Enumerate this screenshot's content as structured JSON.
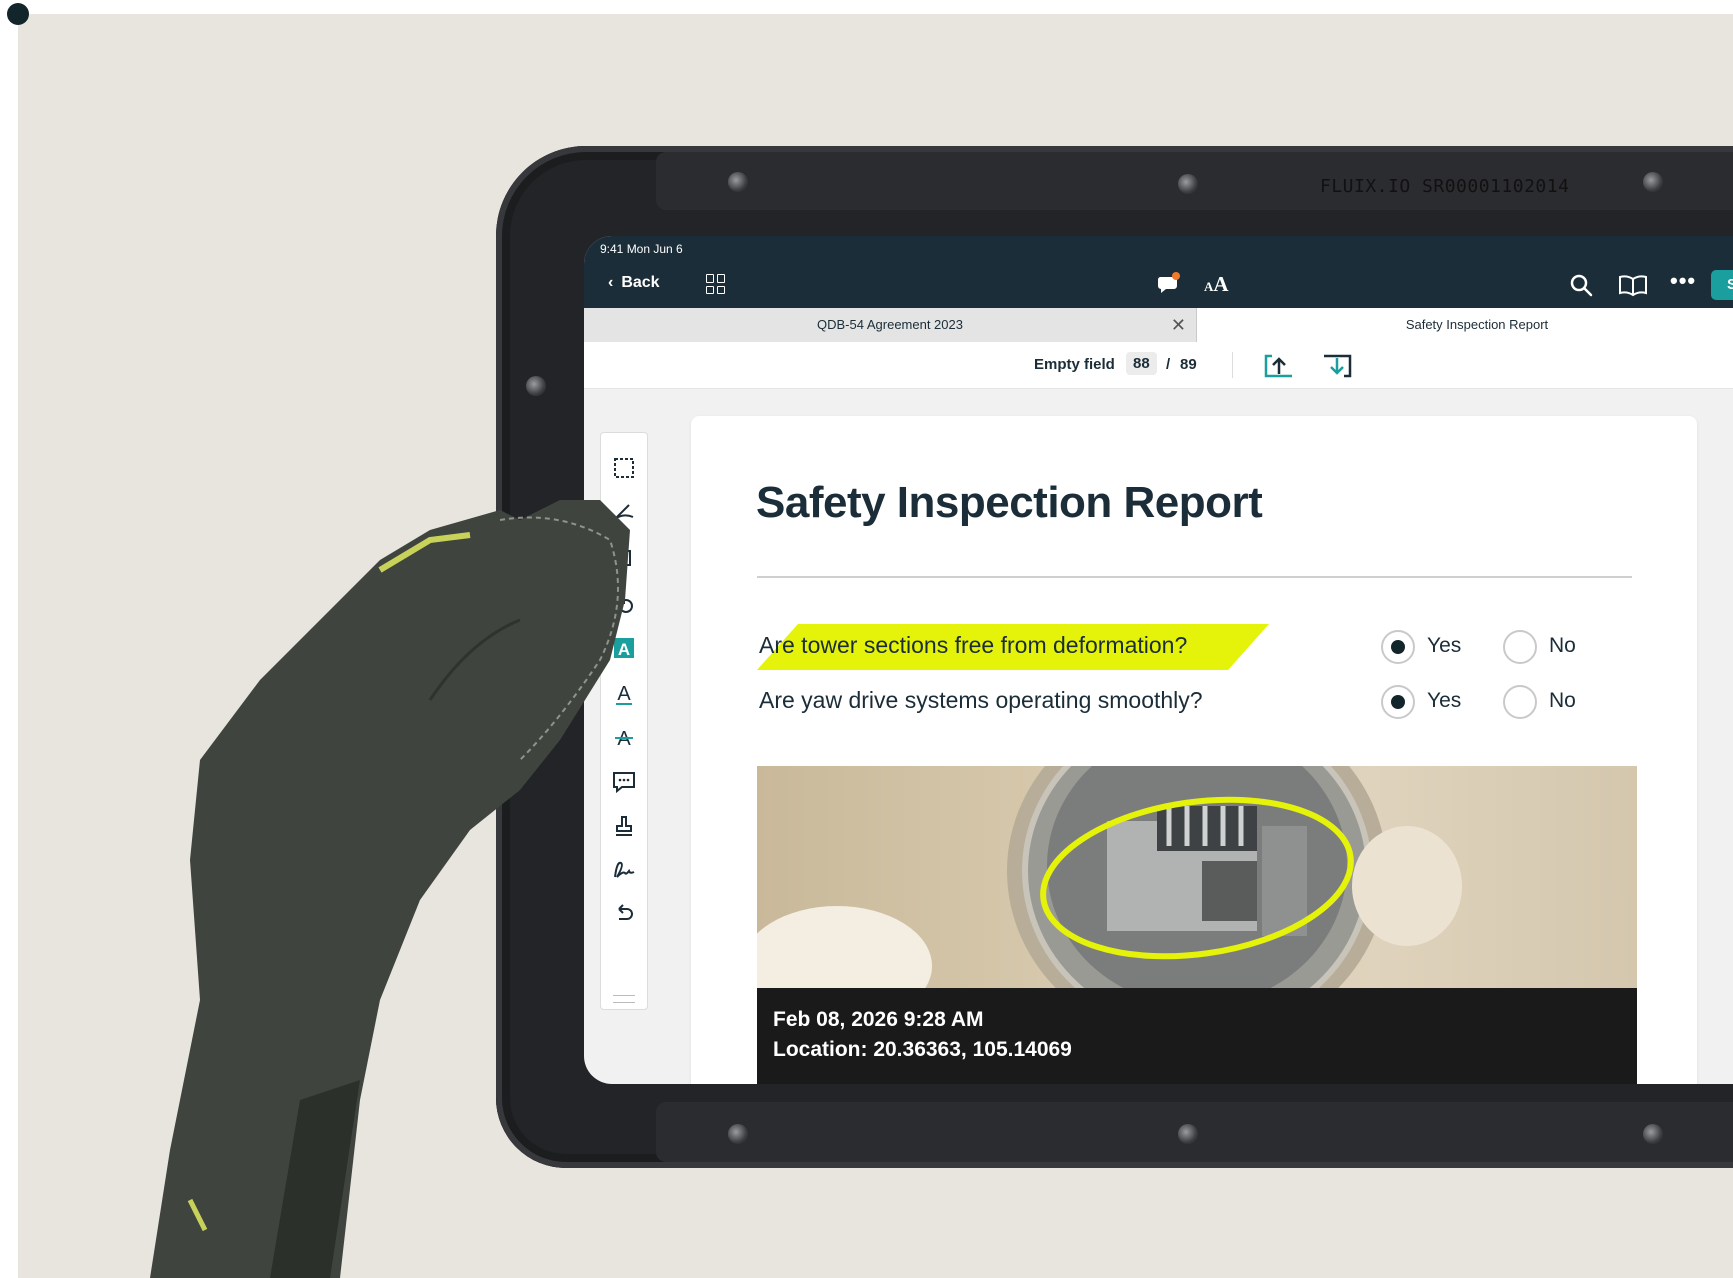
{
  "device": {
    "serial": "FLUIX.IO  SR00001102014"
  },
  "status_bar": {
    "time": "9:41  Mon Jun 6"
  },
  "nav": {
    "back_label": "Back",
    "save_label": "S"
  },
  "tabs": [
    {
      "label": "QDB-54 Agreement 2023"
    },
    {
      "label": "Safety Inspection Report"
    }
  ],
  "field_nav": {
    "label": "Empty field",
    "current": "88",
    "separator": "/",
    "total": "89"
  },
  "tools": [
    "select-area-icon",
    "highlighter-icon",
    "crop-icon",
    "shapes-icon",
    "text-box-icon",
    "underline-text-icon",
    "strikethrough-icon",
    "comment-icon",
    "stamp-icon",
    "signature-icon",
    "undo-icon"
  ],
  "document": {
    "title": "Safety Inspection Report",
    "questions": [
      {
        "text": "Are tower sections free from deformation?",
        "yes": "Yes",
        "no": "No",
        "selected": "Yes"
      },
      {
        "text": "Are yaw drive systems operating smoothly?",
        "yes": "Yes",
        "no": "No",
        "selected": "Yes"
      }
    ],
    "photo": {
      "datetime": "Feb 08, 2026 9:28 AM",
      "location": "Location: 20.36363, 105.14069"
    }
  },
  "colors": {
    "nav_bg": "#1b2d38",
    "accent": "#1a9e9e",
    "highlight": "#e5f20a",
    "notification": "#f07a2a"
  }
}
